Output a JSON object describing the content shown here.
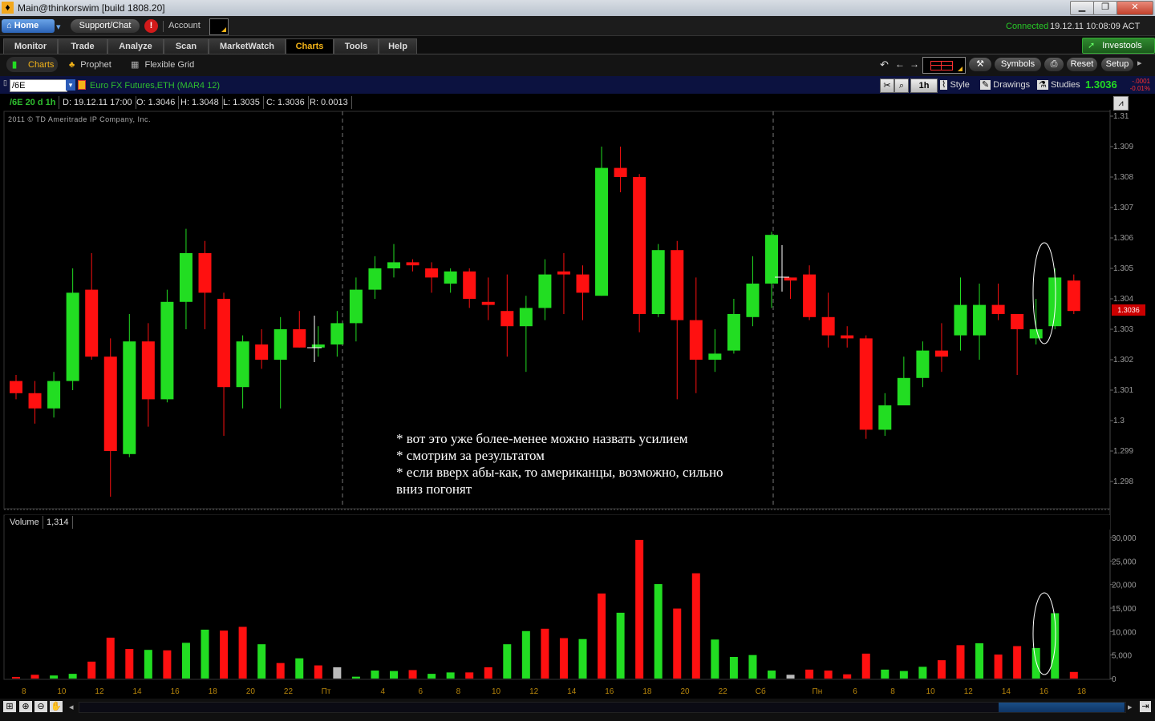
{
  "window": {
    "title": "Main@thinkorswim [build 1808.20]",
    "minimize": "▁",
    "maximize": "❐",
    "close": "✕"
  },
  "status": {
    "home": "Home",
    "support": "Support/Chat",
    "alert": "!",
    "account": "Account",
    "connected": "Connected",
    "datetime": "19.12.11 10:08:09 ACT"
  },
  "menu": {
    "tabs": [
      "Monitor",
      "Trade",
      "Analyze",
      "Scan",
      "MarketWatch",
      "Charts",
      "Tools",
      "Help"
    ],
    "active": "Charts",
    "investools": "Investools"
  },
  "subtabs": {
    "charts": "Charts",
    "prophet": "Prophet",
    "flexible_grid": "Flexible Grid",
    "symbols": "Symbols",
    "reset": "Reset",
    "setup": "Setup"
  },
  "chart_header": {
    "symbol": "/6E",
    "description": "Euro FX Futures,ETH (MAR4 12)",
    "timeframe": "1h",
    "style": "Style",
    "drawings": "Drawings",
    "studies": "Studies",
    "last_price": "1.3036",
    "change": "-.0001",
    "change_pct": "-0.01%"
  },
  "info_row": {
    "label": "/6E 20 d 1h",
    "date": "D: 19.12.11 17:00",
    "open": "O: 1.3046",
    "high": "H: 1.3048",
    "low": "L: 1.3035",
    "close": "C: 1.3036",
    "range": "R: 0.0013"
  },
  "copyright": "2011 © TD Ameritrade IP Company, Inc.",
  "annotation": [
    "* вот это уже более-менее можно назвать усилием",
    "* смотрим за результатом",
    "* если вверх абы-как, то американцы, возможно, сильно",
    "вниз погонят"
  ],
  "volume_panel": {
    "label": "Volume",
    "value": "1,314"
  },
  "colors": {
    "up": "#22dd22",
    "down": "#ff1010",
    "accent": "#f4b418",
    "price_badge": "#cc0000"
  },
  "chart_data": [
    {
      "type": "candlestick",
      "title": "",
      "price_ticks": [
        "1.31",
        "1.309",
        "1.308",
        "1.307",
        "1.306",
        "1.305",
        "1.304",
        "1.303",
        "1.302",
        "1.301",
        "1.3",
        "1.299",
        "1.298"
      ],
      "last_price_label": "1.3036",
      "ylim": [
        1.2975,
        1.3103
      ],
      "candles": [
        {
          "o": 1.3013,
          "h": 1.3015,
          "l": 1.3007,
          "c": 1.3009
        },
        {
          "o": 1.3009,
          "h": 1.3013,
          "l": 1.2999,
          "c": 1.3004
        },
        {
          "o": 1.3004,
          "h": 1.3016,
          "l": 1.3001,
          "c": 1.3013
        },
        {
          "o": 1.3013,
          "h": 1.305,
          "l": 1.301,
          "c": 1.3042
        },
        {
          "o": 1.3043,
          "h": 1.3055,
          "l": 1.302,
          "c": 1.3021
        },
        {
          "o": 1.3021,
          "h": 1.3027,
          "l": 1.2975,
          "c": 1.299
        },
        {
          "o": 1.2989,
          "h": 1.3035,
          "l": 1.2988,
          "c": 1.3026
        },
        {
          "o": 1.3026,
          "h": 1.3032,
          "l": 1.2998,
          "c": 1.3007
        },
        {
          "o": 1.3007,
          "h": 1.3043,
          "l": 1.3006,
          "c": 1.3039
        },
        {
          "o": 1.3039,
          "h": 1.3063,
          "l": 1.303,
          "c": 1.3055
        },
        {
          "o": 1.3055,
          "h": 1.3059,
          "l": 1.303,
          "c": 1.3042
        },
        {
          "o": 1.304,
          "h": 1.3042,
          "l": 1.2995,
          "c": 1.3011
        },
        {
          "o": 1.3011,
          "h": 1.3028,
          "l": 1.3004,
          "c": 1.3026
        },
        {
          "o": 1.3025,
          "h": 1.303,
          "l": 1.3017,
          "c": 1.302
        },
        {
          "o": 1.302,
          "h": 1.3034,
          "l": 1.3004,
          "c": 1.303
        },
        {
          "o": 1.303,
          "h": 1.3036,
          "l": 1.3024,
          "c": 1.3024
        },
        {
          "o": 1.3024,
          "h": 1.3031,
          "l": 1.3021,
          "c": 1.3025
        },
        {
          "o": 1.3025,
          "h": 1.3036,
          "l": 1.3021,
          "c": 1.3032
        },
        {
          "o": 1.3032,
          "h": 1.3047,
          "l": 1.3026,
          "c": 1.3043
        },
        {
          "o": 1.3043,
          "h": 1.3054,
          "l": 1.304,
          "c": 1.305
        },
        {
          "o": 1.305,
          "h": 1.3058,
          "l": 1.3047,
          "c": 1.3052
        },
        {
          "o": 1.3052,
          "h": 1.3053,
          "l": 1.3049,
          "c": 1.3051
        },
        {
          "o": 1.305,
          "h": 1.3052,
          "l": 1.3042,
          "c": 1.3047
        },
        {
          "o": 1.3045,
          "h": 1.305,
          "l": 1.3042,
          "c": 1.3049
        },
        {
          "o": 1.3049,
          "h": 1.305,
          "l": 1.3037,
          "c": 1.304
        },
        {
          "o": 1.3039,
          "h": 1.3047,
          "l": 1.3033,
          "c": 1.3038
        },
        {
          "o": 1.3036,
          "h": 1.3048,
          "l": 1.3021,
          "c": 1.3031
        },
        {
          "o": 1.3031,
          "h": 1.3041,
          "l": 1.3016,
          "c": 1.3037
        },
        {
          "o": 1.3037,
          "h": 1.3053,
          "l": 1.3033,
          "c": 1.3048
        },
        {
          "o": 1.3049,
          "h": 1.3055,
          "l": 1.3035,
          "c": 1.3048
        },
        {
          "o": 1.3048,
          "h": 1.3051,
          "l": 1.3033,
          "c": 1.3042
        },
        {
          "o": 1.3041,
          "h": 1.309,
          "l": 1.3041,
          "c": 1.3083
        },
        {
          "o": 1.3083,
          "h": 1.309,
          "l": 1.3075,
          "c": 1.308
        },
        {
          "o": 1.308,
          "h": 1.3081,
          "l": 1.3029,
          "c": 1.3035
        },
        {
          "o": 1.3035,
          "h": 1.3058,
          "l": 1.3034,
          "c": 1.3056
        },
        {
          "o": 1.3056,
          "h": 1.3059,
          "l": 1.3007,
          "c": 1.3033
        },
        {
          "o": 1.3033,
          "h": 1.3047,
          "l": 1.3009,
          "c": 1.302
        },
        {
          "o": 1.302,
          "h": 1.303,
          "l": 1.3016,
          "c": 1.3022
        },
        {
          "o": 1.3023,
          "h": 1.304,
          "l": 1.3022,
          "c": 1.3035
        },
        {
          "o": 1.3034,
          "h": 1.3054,
          "l": 1.3031,
          "c": 1.3045
        },
        {
          "o": 1.3045,
          "h": 1.3062,
          "l": 1.3037,
          "c": 1.3061
        },
        {
          "o": 1.3047,
          "h": 1.3047,
          "l": 1.304,
          "c": 1.3046
        },
        {
          "o": 1.3048,
          "h": 1.3051,
          "l": 1.3033,
          "c": 1.3034
        },
        {
          "o": 1.3034,
          "h": 1.3042,
          "l": 1.3024,
          "c": 1.3028
        },
        {
          "o": 1.3028,
          "h": 1.3031,
          "l": 1.3024,
          "c": 1.3027
        },
        {
          "o": 1.3027,
          "h": 1.3028,
          "l": 1.2994,
          "c": 1.2997
        },
        {
          "o": 1.2997,
          "h": 1.3009,
          "l": 1.2995,
          "c": 1.3005
        },
        {
          "o": 1.3005,
          "h": 1.3021,
          "l": 1.3005,
          "c": 1.3014
        },
        {
          "o": 1.3014,
          "h": 1.3026,
          "l": 1.3011,
          "c": 1.3023
        },
        {
          "o": 1.3023,
          "h": 1.3032,
          "l": 1.3016,
          "c": 1.3021
        },
        {
          "o": 1.3028,
          "h": 1.3047,
          "l": 1.3023,
          "c": 1.3038
        },
        {
          "o": 1.3028,
          "h": 1.3045,
          "l": 1.302,
          "c": 1.3038
        },
        {
          "o": 1.3038,
          "h": 1.3045,
          "l": 1.3033,
          "c": 1.3035
        },
        {
          "o": 1.3035,
          "h": 1.3035,
          "l": 1.3015,
          "c": 1.303
        },
        {
          "o": 1.3027,
          "h": 1.304,
          "l": 1.3025,
          "c": 1.303
        },
        {
          "o": 1.3031,
          "h": 1.305,
          "l": 1.303,
          "c": 1.3047
        },
        {
          "o": 1.3046,
          "h": 1.3048,
          "l": 1.3035,
          "c": 1.3036
        }
      ],
      "x_ticks": [
        "8",
        "10",
        "12",
        "14",
        "16",
        "18",
        "20",
        "22",
        "Пт",
        "4",
        "6",
        "8",
        "10",
        "12",
        "14",
        "16",
        "18",
        "20",
        "22",
        "Сб",
        "Пн",
        "6",
        "8",
        "10",
        "12",
        "14",
        "16",
        "18"
      ]
    },
    {
      "type": "bar",
      "title": "Volume",
      "y_ticks": [
        "30,000",
        "25,000",
        "20,000",
        "15,000",
        "10,000",
        "5,000",
        "0"
      ],
      "ylim": [
        0,
        30000
      ],
      "values": [
        350,
        800,
        650,
        1000,
        3600,
        8700,
        6300,
        6100,
        6000,
        7600,
        10400,
        10200,
        11000,
        7300,
        3300,
        4300,
        2800,
        2400,
        400,
        1700,
        1600,
        1800,
        1000,
        1300,
        1300,
        2400,
        7300,
        10100,
        10600,
        8600,
        8400,
        18100,
        14000,
        29500,
        20100,
        14900,
        22400,
        8300,
        4600,
        5000,
        1700,
        800,
        1900,
        1700,
        900,
        5300,
        1900,
        1600,
        2500,
        3900,
        7100,
        7500,
        5100,
        6900,
        6500,
        13900,
        1400
      ],
      "colors": [
        "d",
        "d",
        "u",
        "u",
        "d",
        "d",
        "d",
        "u",
        "d",
        "u",
        "u",
        "d",
        "d",
        "u",
        "d",
        "u",
        "d",
        "g",
        "u",
        "u",
        "u",
        "d",
        "u",
        "u",
        "d",
        "d",
        "u",
        "u",
        "d",
        "d",
        "u",
        "d",
        "u",
        "d",
        "u",
        "d",
        "d",
        "u",
        "u",
        "u",
        "u",
        "g",
        "d",
        "d",
        "d",
        "d",
        "u",
        "u",
        "u",
        "d",
        "d",
        "u",
        "d",
        "d",
        "u",
        "u",
        "d"
      ]
    }
  ]
}
